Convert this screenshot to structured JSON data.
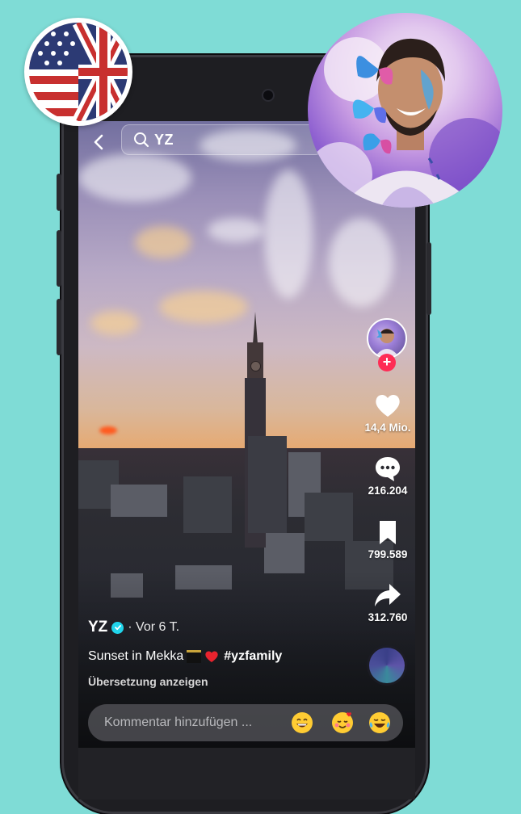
{
  "search": {
    "query": "YZ"
  },
  "rail": {
    "likes": "14,4 Mio.",
    "comments": "216.204",
    "saves": "799.589",
    "shares": "312.760"
  },
  "post": {
    "author": "YZ",
    "time": "· Vor 6 T.",
    "caption": "Sunset in Mekka",
    "hashtag": "#yzfamily",
    "translate": "Übersetzung anzeigen"
  },
  "comment": {
    "placeholder": "Kommentar hinzufügen ..."
  },
  "colors": {
    "background": "#7fdcd6",
    "accent": "#fe2c55",
    "verified": "#20d5ec"
  },
  "icons": [
    "back-arrow-icon",
    "search-icon",
    "heart-icon",
    "comment-icon",
    "bookmark-icon",
    "share-icon",
    "verified-icon",
    "plus-icon",
    "music-disc-icon"
  ]
}
